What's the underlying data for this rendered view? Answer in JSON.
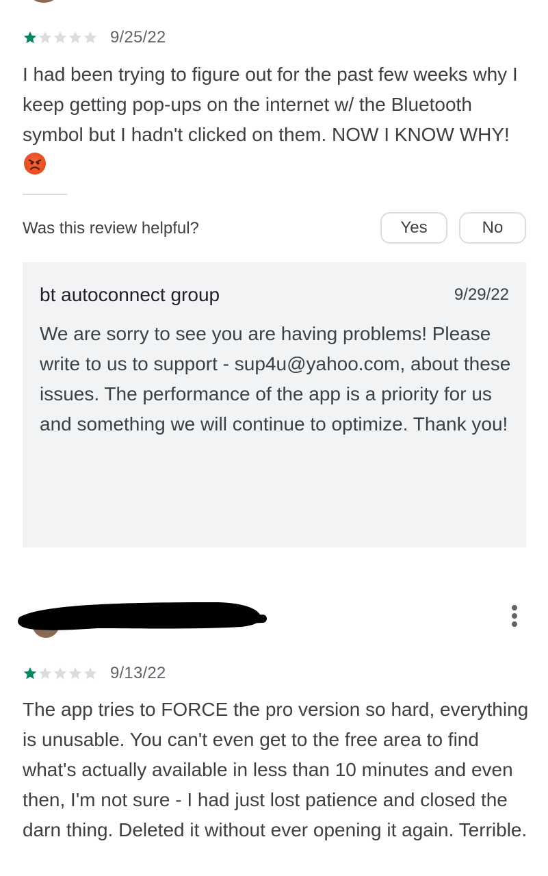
{
  "review1": {
    "rating": 1,
    "max_rating": 5,
    "date": "9/25/22",
    "text_main": "I had been trying to figure out for the past few weeks why I keep getting pop-ups on the internet w/ the Bluetooth symbol but I hadn't clicked on them. NOW I KNOW WHY!",
    "emoji_icon": "angry-face-icon"
  },
  "helpful": {
    "question": "Was this review helpful?",
    "yes_label": "Yes",
    "no_label": "No"
  },
  "developer_reply": {
    "name": "bt autoconnect group",
    "date": "9/29/22",
    "text": "We are sorry to see you are having problems! Please write to us to support - sup4u@yahoo.com, about these issues. The performance of the app is a priority for us and something we will continue to optimize. Thank you!"
  },
  "review2": {
    "rating": 1,
    "max_rating": 5,
    "date": "9/13/22",
    "text": "The app tries to FORCE the pro version so hard, everything is unusable. You can't even get to the free area to find what's actually available in less than 10 minutes and even then, I'm not sure - I had just lost patience and closed the darn thing. Deleted it without ever opening it again. Terrible.",
    "author_redacted": true,
    "menu_icon": "more-vert-icon"
  },
  "colors": {
    "star_filled": "#01875f",
    "star_empty": "#dadce0",
    "reply_background": "#f1f3f4",
    "text_primary": "#3c4043"
  }
}
